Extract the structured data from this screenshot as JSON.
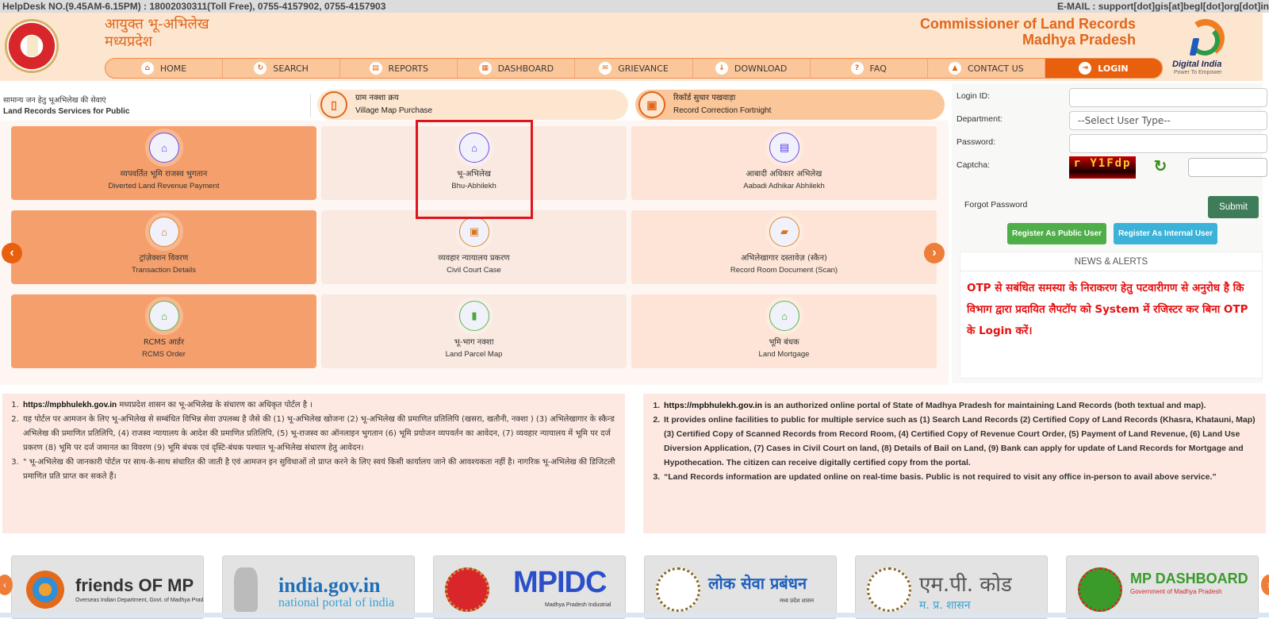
{
  "topbar": {
    "helpdesk": "HelpDesk NO.(9.45AM-6.15PM) : 18002030311(Toll Free), 0755-4157902, 0755-4157903",
    "email": "E-MAIL : support[dot]gis[at]begl[dot]org[dot]in"
  },
  "header": {
    "title_hi_line1": "आयुक्त भू-अभिलेख",
    "title_hi_line2": "मध्यप्रदेश",
    "title_en_line1": "Commissioner of Land Records",
    "title_en_line2": "Madhya Pradesh",
    "digital_india": "Digital India",
    "digital_india_tagline": "Power To Empower"
  },
  "nav": [
    {
      "label": "HOME",
      "icon": "home-icon",
      "glyph": "⌂"
    },
    {
      "label": "SEARCH",
      "icon": "search-refresh-icon",
      "glyph": "↻"
    },
    {
      "label": "REPORTS",
      "icon": "reports-icon",
      "glyph": "▤"
    },
    {
      "label": "DASHBOARD",
      "icon": "dashboard-icon",
      "glyph": "▦"
    },
    {
      "label": "GRIEVANCE",
      "icon": "grievance-icon",
      "glyph": "✉"
    },
    {
      "label": "DOWNLOAD",
      "icon": "download-icon",
      "glyph": "↓"
    },
    {
      "label": "FAQ",
      "icon": "faq-icon",
      "glyph": "?"
    },
    {
      "label": "CONTACT US",
      "icon": "contact-icon",
      "glyph": "▲"
    },
    {
      "label": "LOGIN",
      "icon": "login-icon",
      "glyph": "⇥",
      "active": true
    }
  ],
  "services": {
    "heading_hi": "सामान्य जन हेतु भूअभिलेख की सेवाएं",
    "heading_en": "Land Records Services for Public",
    "pills": [
      {
        "hi": "ग्राम नक्शा क्रय",
        "en": "Village Map Purchase",
        "icon": "map-icon",
        "glyph": "▯"
      },
      {
        "hi": "रिकॉर्ड सुधार पखवाड़ा",
        "en": "Record Correction Fortnight",
        "icon": "calendar-icon",
        "glyph": "▣"
      }
    ],
    "cards": [
      {
        "hi": "व्यपवर्तित भूमि राजस्व भुगतान",
        "en": "Diverted Land Revenue Payment",
        "glyph": "⌂"
      },
      {
        "hi": "भू-अभिलेख",
        "en": "Bhu-Abhilekh",
        "glyph": "⌂"
      },
      {
        "hi": "आबादी अधिकार अभिलेख",
        "en": "Aabadi Adhikar Abhilekh",
        "glyph": "▤"
      },
      {
        "hi": "ट्रांज़ेक्शन विवरण",
        "en": "Transaction Details",
        "glyph": "⌂"
      },
      {
        "hi": "व्यवहार न्यायालय प्रकरण",
        "en": "Civil Court Case",
        "glyph": "▣"
      },
      {
        "hi": "अभिलेखागार दस्तावेज़ (स्कैन)",
        "en": "Record Room Document (Scan)",
        "glyph": "▰"
      },
      {
        "hi": "RCMS आर्डर",
        "en": "RCMS Order",
        "glyph": "⌂"
      },
      {
        "hi": "भू-भाग नक्शा",
        "en": "Land Parcel Map",
        "glyph": "▮"
      },
      {
        "hi": "भूमि बंधक",
        "en": "Land Mortgage",
        "glyph": "⌂"
      }
    ],
    "prev_arrow": "‹",
    "next_arrow": "›"
  },
  "login": {
    "login_id_label": "Login ID:",
    "department_label": "Department:",
    "department_selected": "--Select User Type--",
    "password_label": "Password:",
    "captcha_label": "Captcha:",
    "captcha_text": "r Y1Fdp",
    "refresh_glyph": "↻",
    "forgot_password": "Forgot Password",
    "submit": "Submit",
    "register_public": "Register As Public User",
    "register_internal": "Register As Internal User"
  },
  "news": {
    "title": "NEWS & ALERTS",
    "body": "OTP से सबंधित समस्या के निराकरण हेतु पटवारीगण से अनुरोध है कि विभाग द्वारा प्रदायित लैपटॉप को System में रजिस्टर कर बिना OTP के Login करें।"
  },
  "info_hi": {
    "items": [
      {
        "url": "https://mpbhulekh.gov.in",
        "text": " मध्यप्रदेश शासन का भू-अभिलेख के संधारण का अधिकृत पोर्टल है ।"
      },
      {
        "url": "",
        "text": "यह पोर्टल पर आमजन के लिए भू-अभिलेख से सम्बंधित विभिन्न सेवा उपलब्ध है जैसे की (1) भू-अभिलेख खोजना (2) भू-अभिलेख की प्रमाणित प्रतिलिपि (खसरा, खतौनी, नक्शा ) (3) अभिलेखागार के स्कैन्ड अभिलेख की प्रमाणित प्रतिलिपि, (4) राजस्व न्यायालय के आदेश की प्रमाणित प्रतिलिपि, (5) भू-राजस्व का ऑनलाइन भुगतान (6) भूमि प्रयोजन व्यपवर्तन का आवेदन, (7) व्यवहार न्यायालय में भूमि पर दर्ज प्रकरण (8) भूमि पर दर्ज जमानत का विवरण (9) भूमि बंधक एवं दृस्टि-बंधक पश्चात भू-अभिलेख संधारण हेतु आवेदन।"
      },
      {
        "url": "",
        "text": "\" भू-अभिलेख की जानकारी पोर्टल पर साथ-के-साथ संधारित की जाती है एवं आमजन इन सुविधाओं तो प्राप्त करने के लिए स्वयं किसी कार्यालय जाने की आवश्यकता नहीं है। नागरिक भू-अभिलेख की डिजिटली प्रमाणित प्रति प्राप्त कर सकते हैं।"
      }
    ]
  },
  "info_en": {
    "items": [
      {
        "url": "https://mpbhulekh.gov.in",
        "text": " is an authorized online portal of State of Madhya Pradesh for maintaining Land Records (both textual and map)."
      },
      {
        "url": "",
        "text": "It provides online facilities to public for multiple service such as (1) Search Land Records (2) Certified Copy of Land Records (Khasra, Khatauni, Map) (3) Certified Copy of Scanned Records from Record Room, (4) Certified Copy of Revenue Court Order, (5) Payment of Land Revenue, (6) Land Use Diversion Application, (7) Cases in Civil Court on land, (8) Details of Bail on Land, (9) Bank can apply for update of Land Records for Mortgage and Hypothecation. The citizen can receive digitally certified copy from the portal."
      },
      {
        "url": "",
        "text": "“Land Records information are updated online on real-time basis. Public is not required to visit any office in-person to avail above service.”"
      }
    ]
  },
  "partners": [
    {
      "name": "friends OF MP",
      "sub": "Overseas Indian Department, Govt. of Madhya Pradesh",
      "color": "#e36a1b"
    },
    {
      "name": "india.gov.in",
      "sub": "national portal of india",
      "color": "#1f6fb8"
    },
    {
      "name": "MPIDC",
      "sub": "Madhya Pradesh Industrial",
      "color": "#2a4fc9"
    },
    {
      "name": "लोक सेवा प्रबंधन",
      "sub": "मध्य प्रदेश शासन",
      "color": "#1f5fbf"
    },
    {
      "name": "एम.पी. कोड",
      "sub": "म. प्र. शासन",
      "color": "#555555"
    },
    {
      "name": "MP DASHBOARD",
      "sub": "Government of Madhya Pradesh",
      "color": "#3a9b2a"
    }
  ],
  "colors": {
    "brand_orange": "#e8600d",
    "header_bg": "#fde6cf",
    "nav_bg": "#fbc69a",
    "card_orange": "#f5a06c",
    "alert_red": "#e61010",
    "submit_green": "#3f7d5a",
    "register_green": "#4fae4a",
    "register_blue": "#3bb3d9"
  }
}
